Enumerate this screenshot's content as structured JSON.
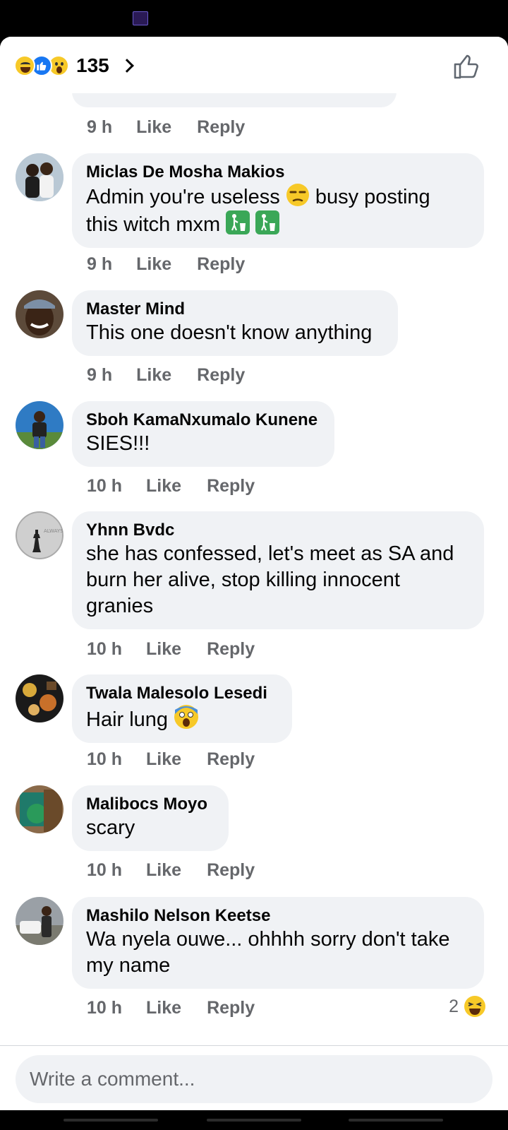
{
  "header": {
    "reaction_icons": [
      "haha-icon",
      "like-icon",
      "wow-icon"
    ],
    "reaction_count": "135"
  },
  "comments": [
    {
      "author": "Miclas De Mosha Makios",
      "text_1": "Admin you're useless",
      "text_2": "busy posting",
      "text_3": "this witch mxm",
      "time": "9 h",
      "like": "Like",
      "reply": "Reply"
    },
    {
      "author": "Master Mind",
      "text": "This one doesn't know anything",
      "time": "9 h",
      "like": "Like",
      "reply": "Reply"
    },
    {
      "author": "Sboh KamaNxumalo Kunene",
      "text": "SIES!!!",
      "time": "10 h",
      "like": "Like",
      "reply": "Reply"
    },
    {
      "author": "Yhnn Bvdc",
      "text": "she has confessed, let's meet as SA and burn her alive, stop killing innocent granies",
      "time": "10 h",
      "like": "Like",
      "reply": "Reply"
    },
    {
      "author": "Twala Malesolo Lesedi",
      "text": "Hair lung",
      "time": "10 h",
      "like": "Like",
      "reply": "Reply"
    },
    {
      "author": "Malibocs Moyo",
      "text": "scary",
      "time": "10 h",
      "like": "Like",
      "reply": "Reply"
    },
    {
      "author": "Mashilo Nelson Keetse",
      "text": "Wa nyela ouwe... ohhhh sorry don't take my name",
      "time": "10 h",
      "like": "Like",
      "reply": "Reply",
      "reaction_count": "2"
    }
  ],
  "top_partial_meta": {
    "time": "9 h",
    "like": "Like",
    "reply": "Reply"
  },
  "composer": {
    "placeholder": "Write a comment..."
  },
  "colors": {
    "bubble": "#f0f2f5",
    "meta_text": "#65676b",
    "like_blue": "#1877f2",
    "emoji_yellow": "#f7c928"
  }
}
